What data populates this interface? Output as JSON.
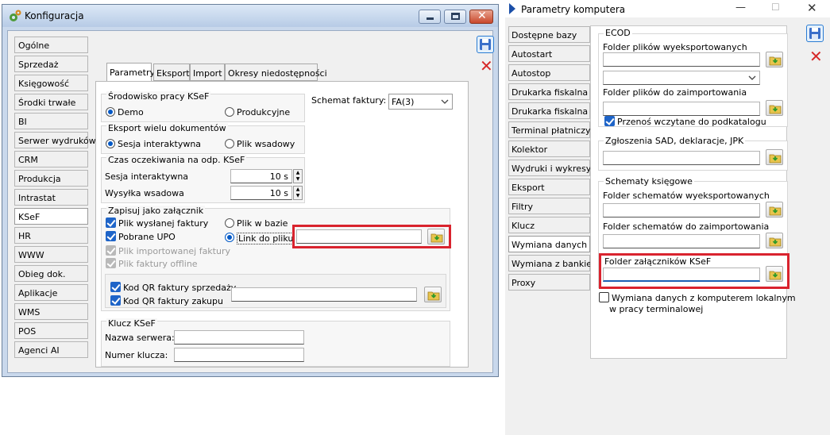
{
  "win1": {
    "title": "Konfiguracja",
    "sidebar": [
      "Ogólne",
      "Sprzedaż",
      "Księgowość",
      "Środki trwałe",
      "BI",
      "Serwer wydruków",
      "CRM",
      "Produkcja",
      "Intrastat",
      "KSeF",
      "HR",
      "WWW",
      "Obieg dok.",
      "Aplikacje",
      "WMS",
      "POS",
      "Agenci AI"
    ],
    "active_sidebar": "KSeF",
    "tabs": [
      "Parametry",
      "Eksport",
      "Import",
      "Okresy niedostępności"
    ],
    "env_group": "Środowisko pracy KSeF",
    "env_demo": "Demo",
    "env_prod": "Produkcyjne",
    "schema_label": "Schemat faktury:",
    "schema_value": "FA(3)",
    "export_group": "Eksport wielu dokumentów",
    "export_interactive": "Sesja interaktywna",
    "export_batch": "Plik wsadowy",
    "wait_group": "Czas oczekiwania na odp. KSeF",
    "wait_session_label": "Sesja interaktywna",
    "wait_session_value": "10 s",
    "wait_batch_label": "Wysyłka wsadowa",
    "wait_batch_value": "10 s",
    "attach_group": "Zapisuj jako załącznik",
    "attach_sent": "Plik wysłanej faktury",
    "attach_upo": "Pobrane UPO",
    "attach_imported": "Plik importowanej faktury",
    "attach_offline": "Plik faktury offline",
    "attach_in_db": "Plik w bazie",
    "attach_link": "Link do pliku",
    "qr_sale": "Kod QR faktury sprzedaży",
    "qr_purchase": "Kod QR faktury zakupu",
    "key_group": "Klucz KSeF",
    "server_label": "Nazwa serwera:",
    "key_number_label": "Numer klucza:"
  },
  "win2": {
    "title": "Parametry komputera",
    "sidebar": [
      "Dostępne bazy",
      "Autostart",
      "Autostop",
      "Drukarka fiskalna",
      "Drukarka fiskalna 2",
      "Terminal płatniczy",
      "Kolektor",
      "Wydruki i wykresy",
      "Eksport",
      "Filtry",
      "Klucz",
      "Wymiana danych",
      "Wymiana z bankiem",
      "Proxy"
    ],
    "active_sidebar": "Wymiana danych",
    "ecod_group": "ECOD",
    "exported_folder": "Folder plików wyeksportowanych",
    "imported_folder": "Folder plików do zaimportowania",
    "move_subfolder": "Przenoś wczytane do podkatalogu",
    "sad_group": "Zgłoszenia SAD, deklaracje, JPK",
    "schemes_group": "Schematy księgowe",
    "schemes_exported": "Folder schematów wyeksportowanych",
    "schemes_imported": "Folder schematów do zaimportowania",
    "ksef_attach_folder": "Folder załączników KSeF",
    "terminal_exchange_1": "Wymiana danych z komputerem lokalnym",
    "terminal_exchange_2": "w pracy terminalowej"
  },
  "colors": {
    "accent": "#1e64c8",
    "highlight": "#d9232e",
    "titlebar": "#c9d8ec"
  }
}
